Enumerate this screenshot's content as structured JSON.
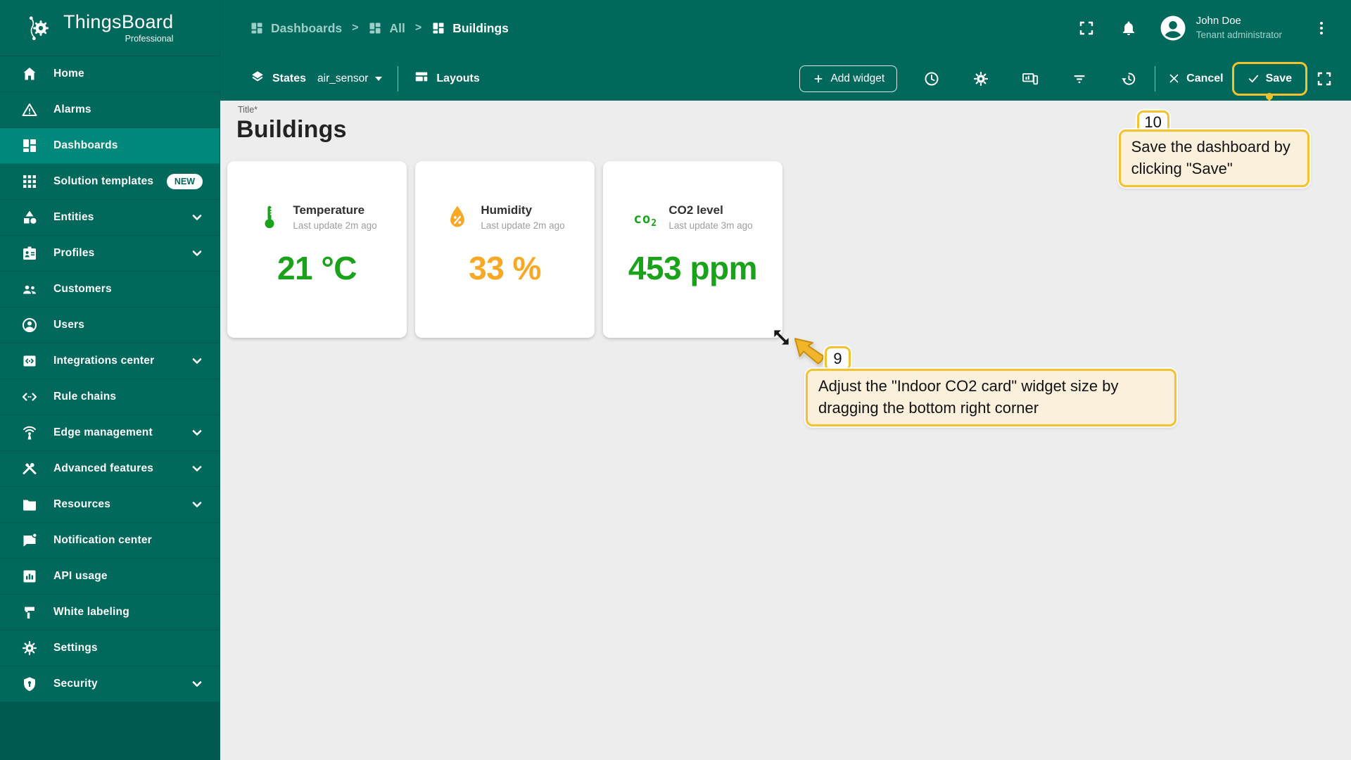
{
  "app": {
    "name": "ThingsBoard",
    "edition": "Professional"
  },
  "breadcrumbs": [
    {
      "label": "Dashboards"
    },
    {
      "label": "All"
    },
    {
      "label": "Buildings"
    }
  ],
  "user": {
    "name": "John Doe",
    "role": "Tenant administrator"
  },
  "sidebar": {
    "items": [
      {
        "label": "Home"
      },
      {
        "label": "Alarms"
      },
      {
        "label": "Dashboards",
        "active": true
      },
      {
        "label": "Solution templates",
        "badge": "NEW"
      },
      {
        "label": "Entities",
        "expandable": true
      },
      {
        "label": "Profiles",
        "expandable": true
      },
      {
        "label": "Customers"
      },
      {
        "label": "Users"
      },
      {
        "label": "Integrations center",
        "expandable": true
      },
      {
        "label": "Rule chains"
      },
      {
        "label": "Edge management",
        "expandable": true
      },
      {
        "label": "Advanced features",
        "expandable": true
      },
      {
        "label": "Resources",
        "expandable": true
      },
      {
        "label": "Notification center"
      },
      {
        "label": "API usage"
      },
      {
        "label": "White labeling"
      },
      {
        "label": "Settings"
      },
      {
        "label": "Security",
        "expandable": true
      }
    ]
  },
  "toolbar": {
    "states_label": "States",
    "state_value": "air_sensor",
    "layouts_label": "Layouts",
    "add_widget_label": "Add widget",
    "cancel_label": "Cancel",
    "save_label": "Save"
  },
  "page": {
    "title_label": "Title*",
    "title": "Buildings"
  },
  "widgets": [
    {
      "title": "Temperature",
      "subtitle": "Last update 2m ago",
      "value": "21 °C",
      "color": "#1AA31A"
    },
    {
      "title": "Humidity",
      "subtitle": "Last update 2m ago",
      "value": "33 %",
      "color": "#F9A825"
    },
    {
      "title": "CO2 level",
      "subtitle": "Last update 3m ago",
      "value": "453 ppm",
      "color": "#1AA31A",
      "icon_text_main": "co",
      "icon_text_sub": "2"
    }
  ],
  "annotations": {
    "step9": {
      "number": "9",
      "text": "Adjust the \"Indoor CO2 card\" widget size by dragging the bottom right corner"
    },
    "step10": {
      "number": "10",
      "text": "Save the dashboard by clicking \"Save\""
    }
  },
  "colors": {
    "teal_primary": "#00695C",
    "teal_active": "#00897B",
    "green_value": "#1AA31A",
    "orange_value": "#F9A825",
    "annotation_yellow": "#F2C230",
    "annotation_bg": "#FBF0DB",
    "content_bg": "#EDEDED"
  }
}
